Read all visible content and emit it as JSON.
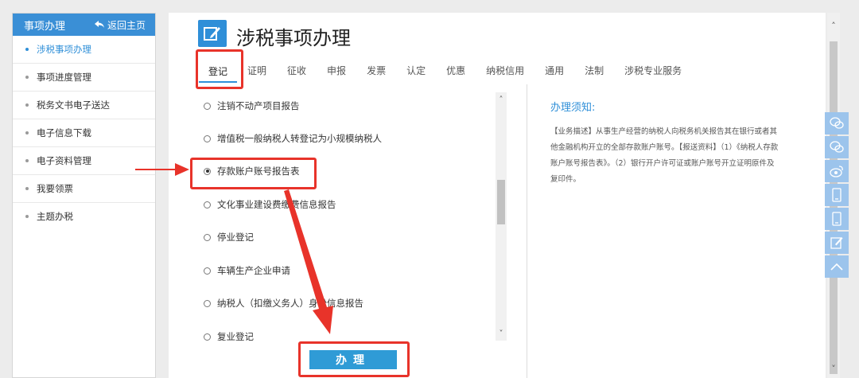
{
  "sidebar": {
    "title": "事项办理",
    "back_label": "返回主页",
    "items": [
      {
        "label": "涉税事项办理"
      },
      {
        "label": "事项进度管理"
      },
      {
        "label": "税务文书电子送达"
      },
      {
        "label": "电子信息下载"
      },
      {
        "label": "电子资料管理"
      },
      {
        "label": "我要领票"
      },
      {
        "label": "主题办税"
      }
    ]
  },
  "page": {
    "title": "涉税事项办理"
  },
  "tabs": [
    {
      "label": "登记"
    },
    {
      "label": "证明"
    },
    {
      "label": "征收"
    },
    {
      "label": "申报"
    },
    {
      "label": "发票"
    },
    {
      "label": "认定"
    },
    {
      "label": "优惠"
    },
    {
      "label": "纳税信用"
    },
    {
      "label": "通用"
    },
    {
      "label": "法制"
    },
    {
      "label": "涉税专业服务"
    }
  ],
  "options": [
    {
      "label": "注销不动产项目报告"
    },
    {
      "label": "增值税一般纳税人转登记为小规模纳税人"
    },
    {
      "label": "存款账户账号报告表"
    },
    {
      "label": "文化事业建设费缴费信息报告"
    },
    {
      "label": "停业登记"
    },
    {
      "label": "车辆生产企业申请"
    },
    {
      "label": "纳税人（扣缴义务人）身份信息报告"
    },
    {
      "label": "复业登记"
    }
  ],
  "selected_option": "存款账户账号报告表",
  "notes": {
    "title": "办理须知:",
    "body": "【业务描述】从事生产经营的纳税人向税务机关报告其在银行或者其他金融机构开立的全部存款账户账号。【报送资料】（1）《纳税人存款账户账号报告表》。（2）银行开户许可证或账户账号开立证明原件及复印件。"
  },
  "submit_label": "办理",
  "colors": {
    "accent": "#2f8fd8",
    "highlight": "#e8332a",
    "button": "#2f9bd6"
  },
  "icons": {
    "title": "edit-icon",
    "back": "back-arrow-icon",
    "float": [
      "wechat-icon",
      "wechat-icon",
      "weibo-icon",
      "mobile-icon",
      "mobile-icon",
      "feedback-icon",
      "back-to-top-icon"
    ]
  }
}
